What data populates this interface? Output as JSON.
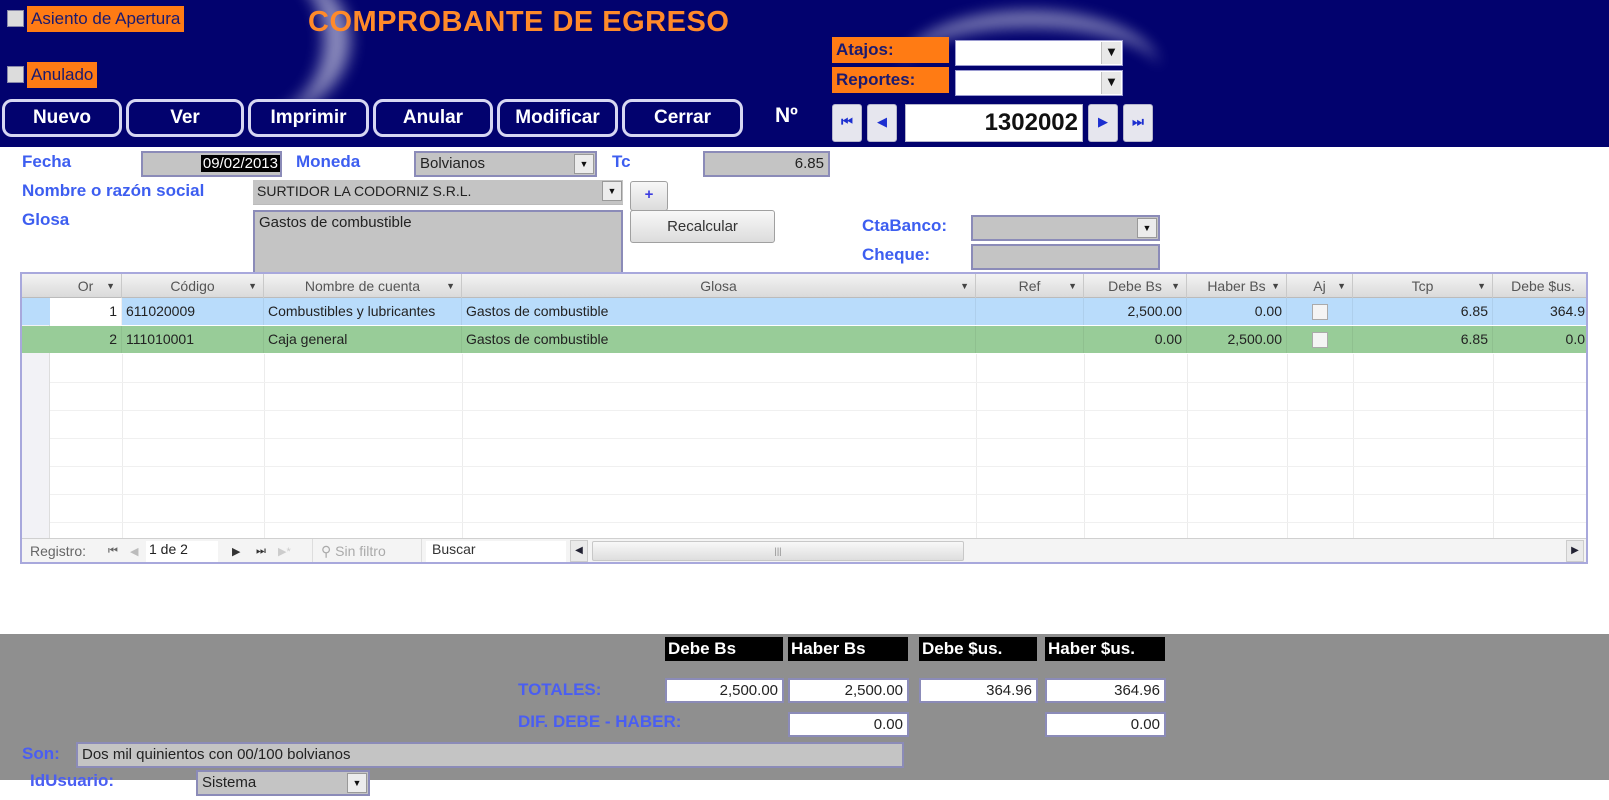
{
  "header": {
    "title": "COMPROBANTE DE EGRESO",
    "asiento_apertura": {
      "label": "Asiento de Apertura",
      "checked": false
    },
    "anulado": {
      "label": "Anulado",
      "checked": false
    },
    "buttons": [
      "Nuevo",
      "Ver",
      "Imprimir",
      "Anular",
      "Modificar",
      "Cerrar"
    ],
    "number_label": "Nº",
    "atajos": {
      "label": "Atajos:",
      "value": ""
    },
    "reportes": {
      "label": "Reportes:",
      "value": ""
    },
    "record_number": "1302002",
    "nav_icons": {
      "first": "⏮",
      "prev": "◀",
      "next": "▶",
      "last": "⏭"
    }
  },
  "form": {
    "fecha": {
      "label": "Fecha",
      "value": "09/02/2013"
    },
    "moneda": {
      "label": "Moneda",
      "value": "Bolvianos"
    },
    "tc": {
      "label": "Tc",
      "value": "6.85"
    },
    "nombre": {
      "label": "Nombre o razón social",
      "value": "SURTIDOR LA CODORNIZ S.R.L."
    },
    "add_button": "+",
    "glosa": {
      "label": "Glosa",
      "value": "Gastos de combustible"
    },
    "recalcular_button": "Recalcular",
    "ctabanco": {
      "label": "CtaBanco:",
      "value": ""
    },
    "cheque": {
      "label": "Cheque:",
      "value": ""
    }
  },
  "grid": {
    "columns": [
      "Or",
      "Código",
      "Nombre de cuenta",
      "Glosa",
      "Ref",
      "Debe Bs",
      "Haber Bs",
      "Aj",
      "Tcp",
      "Debe $us."
    ],
    "rows": [
      {
        "or": "1",
        "codigo": "611020009",
        "nombre": "Combustibles y lubricantes",
        "glosa": "Gastos de combustible",
        "ref": "",
        "debe_bs": "2,500.00",
        "haber_bs": "0.00",
        "aj": false,
        "tcp": "6.85",
        "debe_sus": "364.9"
      },
      {
        "or": "2",
        "codigo": "111010001",
        "nombre": "Caja general",
        "glosa": "Gastos de combustible",
        "ref": "",
        "debe_bs": "0.00",
        "haber_bs": "2,500.00",
        "aj": false,
        "tcp": "6.85",
        "debe_sus": "0.0"
      }
    ],
    "nav": {
      "registro_label": "Registro:",
      "position": "1 de 2",
      "filter_label": "Sin filtro",
      "search_placeholder": "Buscar"
    },
    "colors": {
      "row_selected": "#b9dcfb",
      "row_alt": "#98cc98"
    }
  },
  "totals": {
    "headers": [
      "Debe Bs",
      "Haber Bs",
      "Debe $us.",
      "Haber $us."
    ],
    "totales_label": "TOTALES:",
    "totales": [
      "2,500.00",
      "2,500.00",
      "364.96",
      "364.96"
    ],
    "diff_label": "DIF. DEBE - HABER:",
    "diff_bs": "0.00",
    "diff_sus": "0.00",
    "son_label": "Son:",
    "son_value": "Dos mil quinientos con 00/100 bolvianos",
    "usuario_label": "IdUsuario:",
    "usuario_value": "Sistema"
  }
}
